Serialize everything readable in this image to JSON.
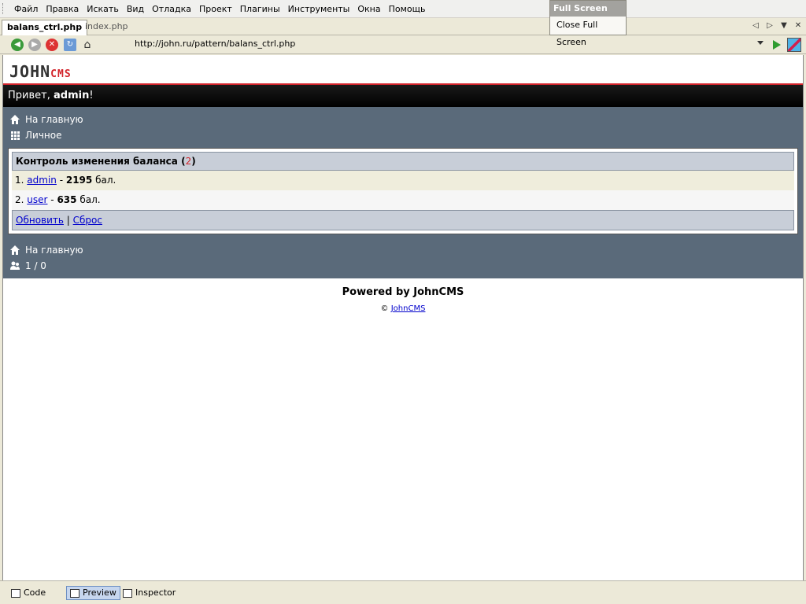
{
  "menu": [
    "Файл",
    "Правка",
    "Искать",
    "Вид",
    "Отладка",
    "Проект",
    "Плагины",
    "Инструменты",
    "Окна",
    "Помощь"
  ],
  "fullscreen": {
    "title": "Full Screen",
    "item": "Close Full Screen"
  },
  "tabs": {
    "active": "balans_ctrl.php",
    "inactive": "index.php"
  },
  "url": "http://john.ru/pattern/balans_ctrl.php",
  "page": {
    "logo_john": "JOHN",
    "logo_cms": "CMS",
    "greeting_prefix": "Привет, ",
    "greeting_user": "admin",
    "greeting_suffix": "!",
    "nav": [
      "На главную",
      "Личное"
    ],
    "header_title": "Контроль изменения баланса ",
    "header_count": "2",
    "rows": [
      {
        "num": "1.",
        "user": "admin",
        "sep": " - ",
        "value": "2195",
        "unit": " бал."
      },
      {
        "num": "2.",
        "user": "user",
        "sep": " - ",
        "value": "635",
        "unit": " бал."
      }
    ],
    "footer_refresh": "Обновить",
    "footer_sep": " | ",
    "footer_reset": "Сброс",
    "foot_home": "На главную",
    "foot_online": "1 / 0",
    "powered": "Powered by JohnCMS",
    "copyright_symbol": "© ",
    "copyright_link": "JohnCMS"
  },
  "statusbar": [
    "Code",
    "Preview",
    "Inspector"
  ]
}
